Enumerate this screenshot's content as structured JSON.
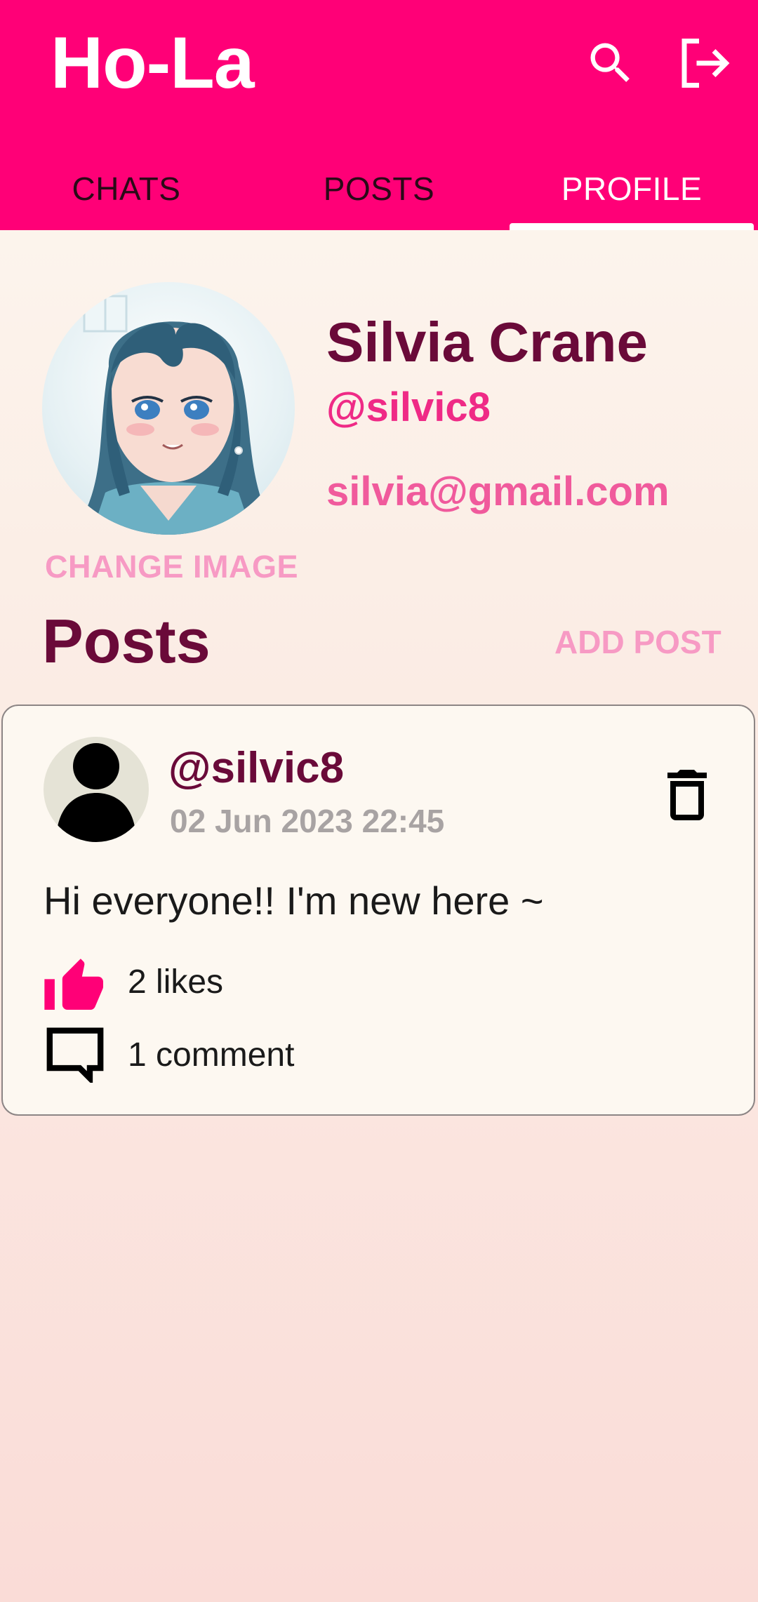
{
  "app": {
    "title": "Ho-La",
    "accent_color": "#ff0077",
    "icons": {
      "search": "search-icon",
      "logout": "logout-icon"
    }
  },
  "tabs": [
    {
      "label": "CHATS",
      "active": false
    },
    {
      "label": "POSTS",
      "active": false
    },
    {
      "label": "PROFILE",
      "active": true
    }
  ],
  "profile": {
    "name": "Silvia Crane",
    "handle": "@silvic8",
    "email": "silvia@gmail.com",
    "change_image_label": "CHANGE IMAGE"
  },
  "posts_section": {
    "heading": "Posts",
    "add_post_label": "ADD POST"
  },
  "posts": [
    {
      "handle": "@silvic8",
      "date": "02 Jun 2023 22:45",
      "text": "Hi everyone!! I'm new here ~",
      "likes_label": "2 likes",
      "comments_label": "1 comment",
      "liked": true
    }
  ]
}
